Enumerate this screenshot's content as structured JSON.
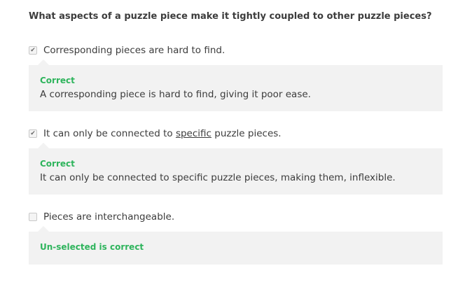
{
  "question": "What aspects of a puzzle piece make it tightly coupled to other puzzle pieces?",
  "options": [
    {
      "checked": true,
      "text_before": "Corresponding pieces are hard to find.",
      "feedback_title": "Correct",
      "feedback_text": "A corresponding piece is hard to find, giving it poor ease."
    },
    {
      "checked": true,
      "text_before": "It can only be connected to ",
      "text_underlined": "specific",
      "text_after": " puzzle pieces.",
      "feedback_title": "Correct",
      "feedback_text": "It can only be connected to specific puzzle pieces, making them, inflexible."
    },
    {
      "checked": false,
      "text_before": "Pieces are interchangeable.",
      "feedback_title": "Un-selected is correct"
    }
  ],
  "checkmark_glyph": "✔",
  "colors": {
    "correct": "#2eb45c",
    "feedback_bg": "#f2f2f2",
    "text": "#3c3c3c"
  }
}
